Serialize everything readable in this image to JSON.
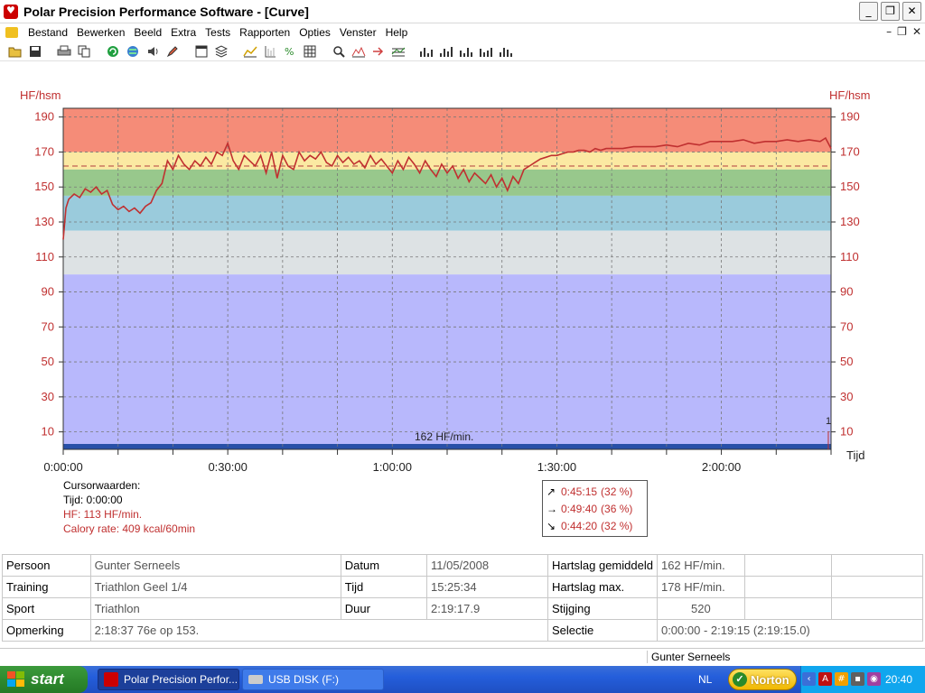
{
  "window": {
    "title": "Polar Precision Performance Software - [Curve]",
    "buttons": [
      "_",
      "❐",
      "✕"
    ],
    "mdi_buttons": [
      "–",
      "❐",
      "✕"
    ]
  },
  "menu": [
    "Bestand",
    "Bewerken",
    "Beeld",
    "Extra",
    "Tests",
    "Rapporten",
    "Opties",
    "Venster",
    "Help"
  ],
  "toolbar": {
    "icons": [
      "open-icon",
      "save-icon",
      "print-icon",
      "copy-icon",
      "refresh-icon",
      "globe-icon",
      "sound-icon",
      "pen-icon",
      "window-icon",
      "book-icon",
      "graph-icon",
      "axis-icon",
      "percent-icon",
      "table-icon",
      "zoom-icon",
      "chart-icon",
      "arrow-icon",
      "lines-icon",
      "bar1-icon",
      "bar2-icon",
      "bar3-icon",
      "bar4-icon",
      "bar5-icon"
    ]
  },
  "chart_data": {
    "type": "line",
    "ylabel_left": "HF/hsm",
    "ylabel_right": "HF/hsm",
    "xlabel": "Tijd",
    "y_ticks": [
      190,
      170,
      150,
      130,
      110,
      90,
      70,
      50,
      30,
      10
    ],
    "x_ticks": [
      "0:00:00",
      "0:30:00",
      "1:00:00",
      "1:30:00",
      "2:00:00"
    ],
    "xlim_minutes": [
      0,
      140
    ],
    "ylim": [
      0,
      195
    ],
    "zones": [
      {
        "from": 170,
        "to": 195,
        "color": "#f58c78"
      },
      {
        "from": 160,
        "to": 170,
        "color": "#fbe9a2"
      },
      {
        "from": 145,
        "to": 160,
        "color": "#98c88c"
      },
      {
        "from": 125,
        "to": 145,
        "color": "#9acbdc"
      },
      {
        "from": 100,
        "to": 125,
        "color": "#dde2e4"
      },
      {
        "from": 0,
        "to": 100,
        "color": "#b8b8fc"
      }
    ],
    "avg_line": 162,
    "avg_label": "162 HF/min.",
    "end_marker_label": "1",
    "series": [
      {
        "color": "#c03030",
        "x": [
          0,
          0.5,
          1,
          2,
          3,
          4,
          5,
          6,
          7,
          8,
          9,
          10,
          11,
          12,
          13,
          14,
          15,
          16,
          17,
          18,
          19,
          20,
          21,
          22,
          23,
          24,
          25,
          26,
          27,
          28,
          29,
          30,
          31,
          32,
          33,
          34,
          35,
          36,
          37,
          38,
          39,
          40,
          41,
          42,
          43,
          44,
          45,
          46,
          47,
          48,
          49,
          50,
          51,
          52,
          53,
          54,
          55,
          56,
          57,
          58,
          59,
          60,
          61,
          62,
          63,
          64,
          65,
          66,
          67,
          68,
          69,
          70,
          71,
          72,
          73,
          74,
          75,
          76,
          77,
          78,
          79,
          80,
          81,
          82,
          83,
          84,
          85,
          86,
          87,
          88,
          89,
          90,
          91,
          92,
          93,
          94,
          95,
          96,
          97,
          98,
          99,
          100,
          102,
          104,
          106,
          108,
          110,
          112,
          114,
          116,
          118,
          120,
          122,
          124,
          126,
          128,
          130,
          132,
          134,
          136,
          138,
          139,
          140
        ],
        "values": [
          120,
          138,
          143,
          146,
          144,
          149,
          147,
          150,
          146,
          148,
          140,
          137,
          139,
          136,
          138,
          135,
          139,
          141,
          148,
          152,
          165,
          160,
          168,
          163,
          160,
          165,
          162,
          167,
          163,
          170,
          168,
          175,
          165,
          160,
          168,
          165,
          162,
          168,
          158,
          170,
          155,
          168,
          162,
          160,
          170,
          165,
          168,
          166,
          170,
          164,
          162,
          168,
          164,
          167,
          163,
          165,
          161,
          168,
          163,
          166,
          162,
          158,
          165,
          160,
          167,
          163,
          158,
          165,
          160,
          156,
          163,
          158,
          162,
          155,
          160,
          153,
          158,
          155,
          152,
          157,
          150,
          155,
          148,
          156,
          152,
          160,
          162,
          164,
          166,
          167,
          168,
          168,
          169,
          170,
          170,
          171,
          171,
          170,
          172,
          171,
          172,
          172,
          172,
          173,
          173,
          173,
          174,
          173,
          175,
          174,
          176,
          176,
          176,
          177,
          175,
          176,
          176,
          177,
          176,
          177,
          176,
          178,
          172
        ]
      }
    ]
  },
  "cursor": {
    "title": "Cursorwaarden:",
    "tijd": "Tijd: 0:00:00",
    "hf": "HF: 113 HF/min.",
    "calory": "Calory rate: 409 kcal/60min"
  },
  "trend": [
    {
      "arrow": "↗",
      "value": "0:45:15",
      "pct": "(32 %)"
    },
    {
      "arrow": "→",
      "value": "0:49:40",
      "pct": "(36 %)"
    },
    {
      "arrow": "↘",
      "value": "0:44:20",
      "pct": "(32 %)"
    }
  ],
  "info": {
    "rows": [
      [
        "Persoon",
        "Gunter Serneels",
        "Datum",
        "11/05/2008",
        "Hartslag gemiddeld",
        "162 HF/min.",
        "",
        ""
      ],
      [
        "Training",
        "Triathlon Geel 1/4",
        "Tijd",
        "15:25:34",
        "Hartslag max.",
        "178 HF/min.",
        "",
        ""
      ],
      [
        "Sport",
        "Triathlon",
        "Duur",
        "2:19:17.9",
        "Stijging",
        "520",
        "",
        ""
      ],
      [
        "Opmerking",
        "2:18:37  76e op 153.",
        "",
        "",
        "Selectie",
        "0:00:00 - 2:19:15 (2:19:15.0)",
        "",
        ""
      ]
    ]
  },
  "status": {
    "user": "Gunter Serneels"
  },
  "taskbar": {
    "start": "start",
    "items": [
      "Polar Precision Perfor...",
      "USB DISK (F:)"
    ],
    "lang": "NL",
    "norton": "Norton",
    "clock": "20:40"
  }
}
